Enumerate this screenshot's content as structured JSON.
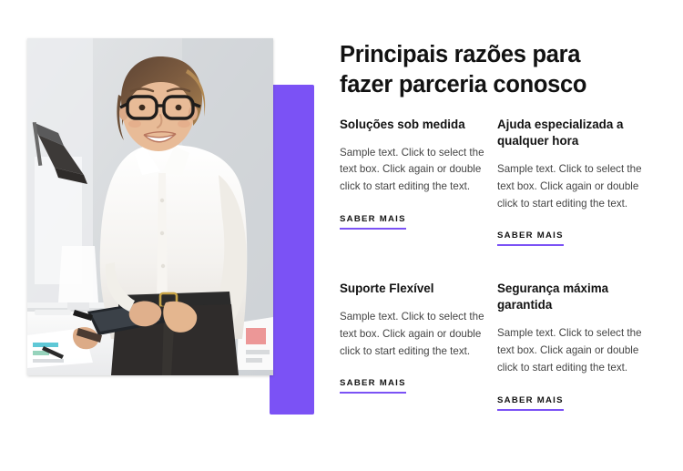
{
  "theme": {
    "accent": "#7B52F5",
    "heading_color": "#121212",
    "body_color": "#444444",
    "background": "#ffffff"
  },
  "hero": {
    "headline": "Principais razões para fazer parceria conosco",
    "image_alt": "Mulher sorridente de óculos e camisa branca segurando um tablet em um escritório"
  },
  "cards": [
    {
      "title": "Soluções sob medida",
      "body": "Sample text. Click to select the text box. Click again or double click to start editing the text.",
      "link_label": "SABER MAIS"
    },
    {
      "title": "Ajuda especializada a qualquer hora",
      "body": "Sample text. Click to select the text box. Click again or double click to start editing the text.",
      "link_label": "SABER MAIS"
    },
    {
      "title": "Suporte Flexível",
      "body": "Sample text. Click to select the text box. Click again or double click to start editing the text.",
      "link_label": "SABER MAIS"
    },
    {
      "title": "Segurança máxima garantida",
      "body": "Sample text. Click to select the text box. Click again or double click to start editing the text.",
      "link_label": "SABER MAIS"
    }
  ]
}
